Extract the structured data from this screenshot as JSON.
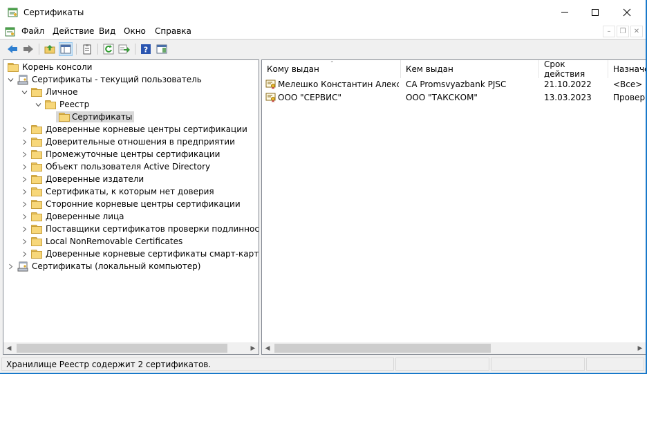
{
  "window": {
    "title": "Сертификаты",
    "controls": [
      "minimize",
      "maximize",
      "close"
    ]
  },
  "menu": {
    "items": [
      "Файл",
      "Действие",
      "Вид",
      "Окно",
      "Справка"
    ]
  },
  "toolbar": {
    "buttons": [
      "back-icon",
      "forward-icon",
      "up-folder-icon",
      "show-hide-tree-icon",
      "properties-icon",
      "refresh-icon",
      "export-list-icon",
      "help-icon",
      "action-pane-icon"
    ]
  },
  "tree": {
    "root": "Корень консоли",
    "current_user": "Сертификаты - текущий пользователь",
    "personal": "Личное",
    "registry": "Реестр",
    "certificates": "Сертификаты",
    "stores": [
      "Доверенные корневые центры сертификации",
      "Доверительные отношения в предприятии",
      "Промежуточные центры сертификации",
      "Объект пользователя Active Directory",
      "Доверенные издатели",
      "Сертификаты, к которым нет доверия",
      "Сторонние корневые центры сертификации",
      "Доверенные лица",
      "Поставщики сертификатов проверки подлинности кли",
      "Local NonRemovable Certificates",
      "Доверенные корневые сертификаты смарт-карты"
    ],
    "local_computer": "Сертификаты (локальный компьютер)"
  },
  "list": {
    "columns": [
      "Кому выдан",
      "Кем выдан",
      "Срок действия",
      "Назначе"
    ],
    "rows": [
      {
        "issued_to": "Мелешко Константин Алекса...",
        "issued_by": "CA Promsvyazbank PJSC",
        "expires": "21.10.2022",
        "purpose": "<Все>"
      },
      {
        "issued_to": "ООО \"СЕРВИС\"",
        "issued_by": "ООО \"ТАКСКОМ\"",
        "expires": "13.03.2023",
        "purpose": "Провер"
      }
    ]
  },
  "status": {
    "text": "Хранилище Реестр содержит 2 сертификатов."
  },
  "colors": {
    "accent": "#1979ca",
    "selection": "#d9d9d9",
    "folder": "#f7d77a"
  }
}
